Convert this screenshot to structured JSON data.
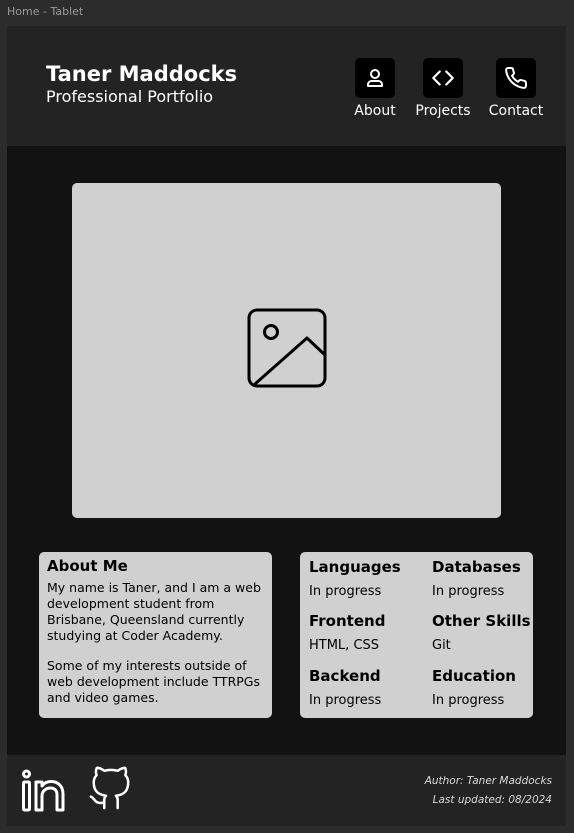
{
  "canvas": {
    "frame_label": "Home - Tablet"
  },
  "header": {
    "title": "Taner Maddocks",
    "subtitle": "Professional Portfolio",
    "nav": [
      {
        "label": "About",
        "icon": "user-icon"
      },
      {
        "label": "Projects",
        "icon": "code-icon"
      },
      {
        "label": "Contact",
        "icon": "phone-icon"
      }
    ]
  },
  "hero": {
    "icon": "image-placeholder-icon"
  },
  "about": {
    "title": "About Me",
    "paragraphs": [
      "My name is Taner, and I am a web development student from Brisbane, Queensland currently studying at Coder Academy.",
      "Some of my interests outside of web development include TTRPGs and video games."
    ]
  },
  "skills": [
    {
      "title": "Languages",
      "value": "In progress"
    },
    {
      "title": "Databases",
      "value": "In progress"
    },
    {
      "title": "Frontend",
      "value": "HTML, CSS"
    },
    {
      "title": "Other Skills",
      "value": "Git"
    },
    {
      "title": "Backend",
      "value": "In progress"
    },
    {
      "title": "Education",
      "value": "In progress"
    }
  ],
  "footer": {
    "author": "Author: Taner Maddocks",
    "updated": "Last updated: 08/2024",
    "social": [
      {
        "icon": "linkedin-icon"
      },
      {
        "icon": "github-icon"
      }
    ]
  },
  "colors": {
    "canvas": "#2c2c2c",
    "page_bg": "#121212",
    "header_bg": "#232323",
    "card_bg": "#d0d0d0",
    "text_light": "#ffffff"
  }
}
